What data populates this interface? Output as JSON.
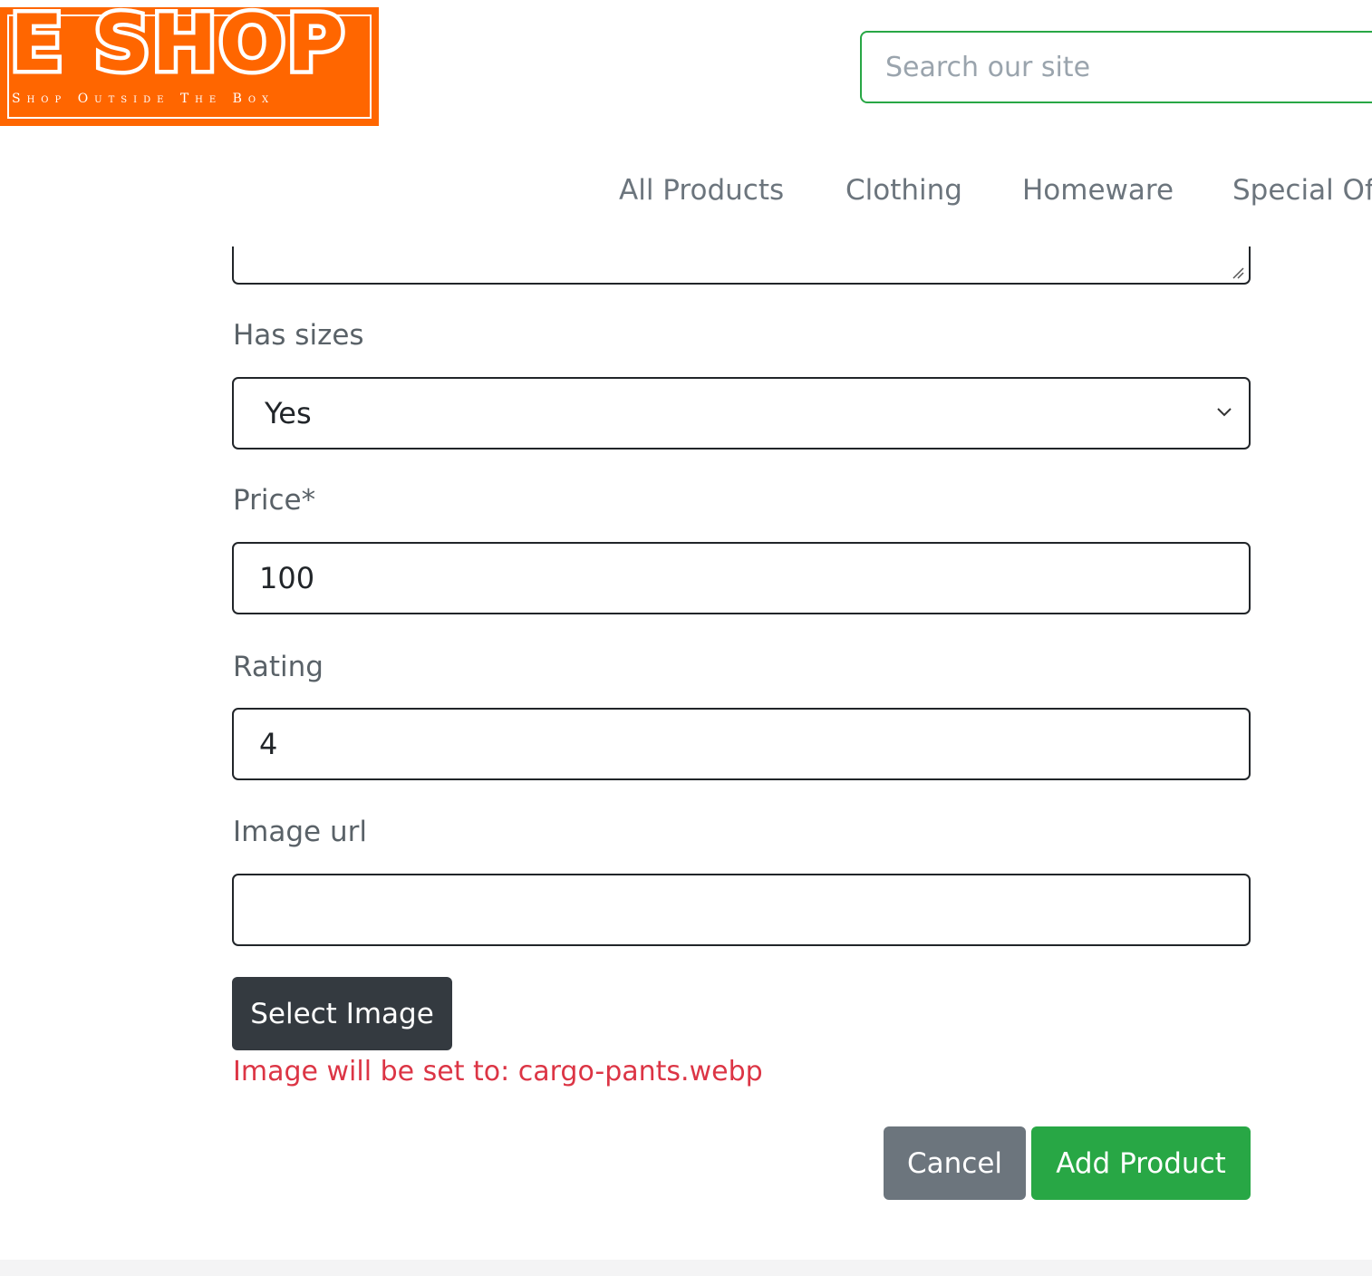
{
  "header": {
    "logo_title": "E SHOP",
    "logo_tagline": "Shop Outside The Box",
    "search_placeholder": "Search our site",
    "nav": [
      "All Products",
      "Clothing",
      "Homeware",
      "Special Offers"
    ]
  },
  "form": {
    "has_sizes": {
      "label": "Has sizes",
      "value": "Yes"
    },
    "price": {
      "label": "Price*",
      "value": "100"
    },
    "rating": {
      "label": "Rating",
      "value": "4"
    },
    "image_url": {
      "label": "Image url",
      "value": ""
    },
    "select_image_label": "Select Image",
    "image_note": "Image will be set to: cargo-pants.webp",
    "cancel_label": "Cancel",
    "submit_label": "Add Product"
  },
  "colors": {
    "brand_orange": "#ff6600",
    "accent_green": "#28a745",
    "danger_red": "#dc3545",
    "dark": "#343a40",
    "secondary_gray": "#6c757d"
  }
}
